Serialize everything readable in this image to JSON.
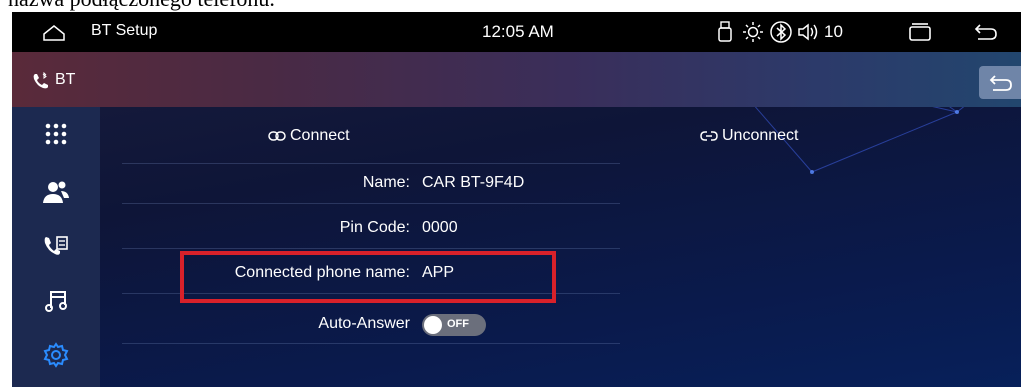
{
  "caption": {
    "text": "nazwa podłączonego telefonu."
  },
  "status_bar": {
    "title": "BT Setup",
    "time": "12:05 AM",
    "volume": "10"
  },
  "header": {
    "title": "BT"
  },
  "actions": {
    "connect_label": "Connect",
    "unconnect_label": "Unconnect"
  },
  "settings": {
    "name": {
      "label": "Name:",
      "value": "CAR BT-9F4D"
    },
    "pin": {
      "label": "Pin Code:",
      "value": "0000"
    },
    "phone": {
      "label": "Connected phone name:",
      "value": "APP"
    },
    "auto_answer": {
      "label": "Auto-Answer",
      "state": "OFF"
    }
  },
  "sidebar": {
    "items": [
      {
        "icon": "apps-grid-icon"
      },
      {
        "icon": "contacts-icon"
      },
      {
        "icon": "call-log-icon"
      },
      {
        "icon": "music-icon"
      },
      {
        "icon": "settings-gear-icon",
        "active": true
      }
    ]
  },
  "colors": {
    "highlight": "#d8212a",
    "sidebar_bg": "#1c2950",
    "active_icon": "#2a8cff"
  }
}
